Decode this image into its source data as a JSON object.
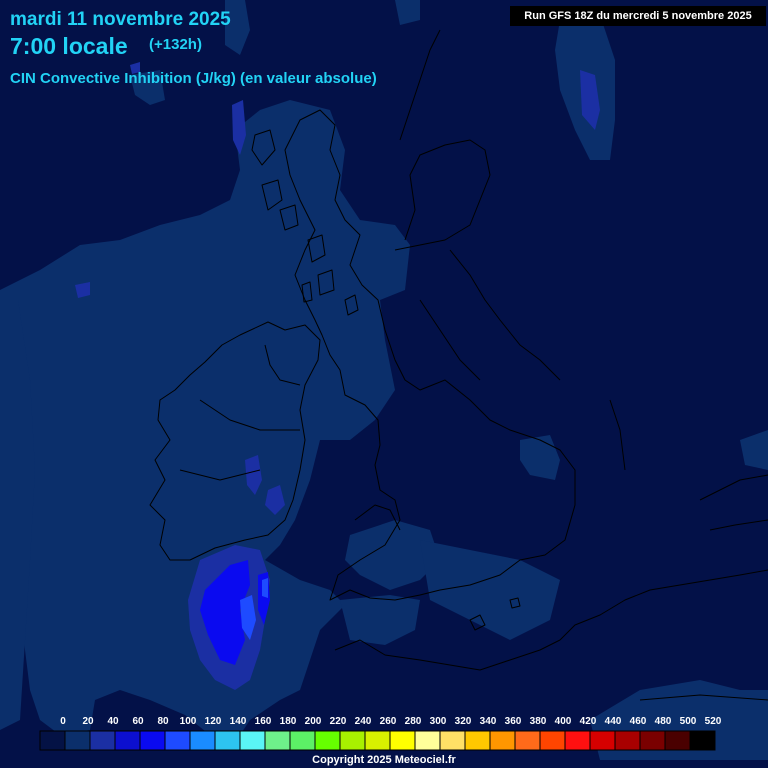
{
  "header": {
    "date": "mardi 11 novembre 2025",
    "time": "7:00 locale",
    "lead": "(+132h)",
    "parameter": "CIN Convective Inhibition (J/kg) (en valeur absolue)",
    "run": "Run GFS 18Z du mercredi 5 novembre 2025"
  },
  "legend": {
    "labels": [
      "0",
      "20",
      "40",
      "60",
      "80",
      "100",
      "120",
      "140",
      "160",
      "180",
      "200",
      "220",
      "240",
      "260",
      "280",
      "300",
      "320",
      "340",
      "360",
      "380",
      "400",
      "420",
      "440",
      "460",
      "480",
      "500",
      "520"
    ],
    "colors": [
      "#041245",
      "#0b2f6b",
      "#1b2fa3",
      "#0c0fcf",
      "#0a0af0",
      "#1e4bff",
      "#1a8cff",
      "#2dc4f0",
      "#5af5f5",
      "#6ef08a",
      "#5cf066",
      "#66ff00",
      "#a8f000",
      "#d8f000",
      "#ffff00",
      "#ffff9a",
      "#ffe066",
      "#ffc800",
      "#ff9600",
      "#ff6a1a",
      "#ff4500",
      "#ff1010",
      "#d60000",
      "#a80000",
      "#7a0000",
      "#4a0000",
      "#000000"
    ]
  },
  "copyright": "Copyright 2025 Meteociel.fr",
  "colors": {
    "sea_background": "#031148",
    "cin_low": "#0b2f6b",
    "cin_mid": "#1b2fa3",
    "cin_high": "#0a0af0",
    "cin_peak": "#1e4bff",
    "title_text": "#22d3f5",
    "coastline": "#000000"
  }
}
